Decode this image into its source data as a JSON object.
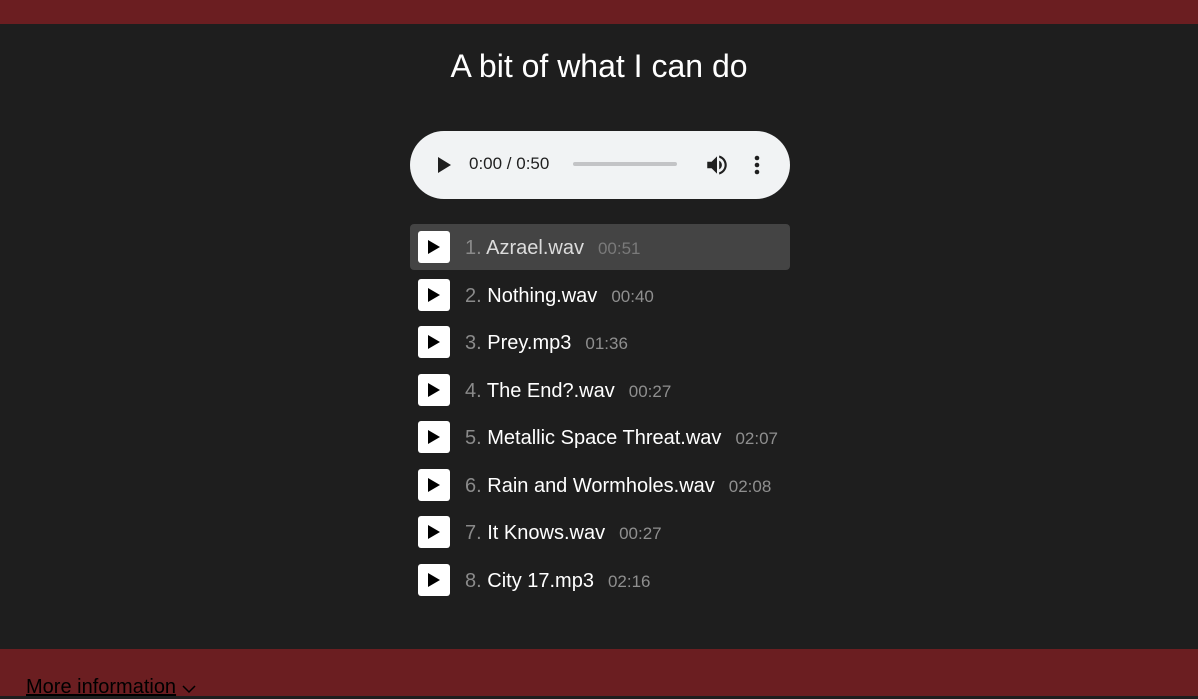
{
  "header": {
    "title": "A bit of what I can do"
  },
  "audio_player": {
    "time_display": "0:00 / 0:50",
    "progress": 0,
    "icons": [
      "play-icon",
      "volume-icon",
      "more-vert-icon"
    ]
  },
  "playlist": {
    "tracks": [
      {
        "number": "1.",
        "name": "Azrael.wav",
        "duration": "00:51",
        "active": true
      },
      {
        "number": "2.",
        "name": "Nothing.wav",
        "duration": "00:40"
      },
      {
        "number": "3.",
        "name": "Prey.mp3",
        "duration": "01:36"
      },
      {
        "number": "4.",
        "name": "The End?.wav",
        "duration": "00:27"
      },
      {
        "number": "5.",
        "name": "Metallic Space Threat.wav",
        "duration": "02:07"
      },
      {
        "number": "6.",
        "name": "Rain and Wormholes.wav",
        "duration": "02:08"
      },
      {
        "number": "7.",
        "name": "It Knows.wav",
        "duration": "00:27"
      },
      {
        "number": "8.",
        "name": "City 17.mp3",
        "duration": "02:16"
      }
    ]
  },
  "footer": {
    "more_info_label": "More information",
    "chevron_icon": "chevron-down-icon"
  },
  "colors": {
    "background": "#1e1e1e",
    "accent_bar": "#6b1e21",
    "active_track": "#444444",
    "player_bg": "#f1f3f4"
  }
}
